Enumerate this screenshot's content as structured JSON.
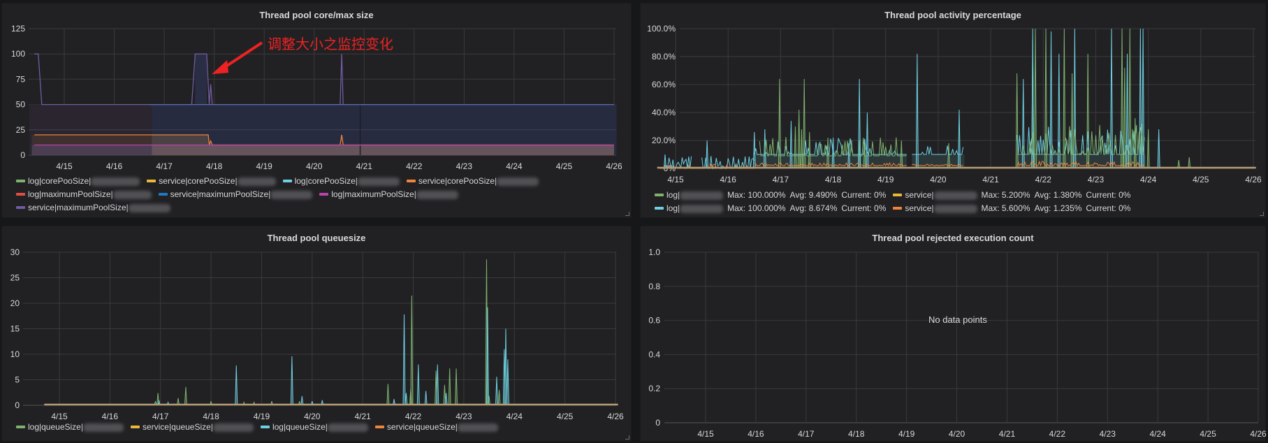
{
  "panels": {
    "core_max": {
      "title": "Thread pool core/max size",
      "annotation": "调整大小之监控变化",
      "legend": [
        {
          "label": "log|corePooSize|",
          "color": "#7eb26d",
          "blur": 70
        },
        {
          "label": "service|corePooSize|",
          "color": "#eab839",
          "blur": 55
        },
        {
          "label": "log|corePooSize|",
          "color": "#6ed0e0",
          "blur": 60
        },
        {
          "label": "service|corePooSize|",
          "color": "#ef843c",
          "blur": 60
        },
        {
          "label": "log|maximumPoolSize|",
          "color": "#e24d42",
          "blur": 55
        },
        {
          "label": "service|maximumPoolSize|",
          "color": "#1f78c1",
          "blur": 60
        },
        {
          "label": "log|maximumPoolSize|",
          "color": "#ba43a9",
          "blur": 60
        },
        {
          "label": "service|maximumPoolSize|",
          "color": "#705da0",
          "blur": 60
        }
      ]
    },
    "activity": {
      "title": "Thread pool activity percentage",
      "legend": [
        {
          "label": "log|",
          "color": "#7eb26d",
          "max": "Max: 100.000%",
          "avg": "Avg: 9.490%",
          "current": "Current: 0%"
        },
        {
          "label": "service|",
          "color": "#eab839",
          "max": "Max: 5.200%",
          "avg": "Avg: 1.380%",
          "current": "Current: 0%"
        },
        {
          "label": "log|",
          "color": "#6ed0e0",
          "max": "Max: 100.000%",
          "avg": "Avg: 8.674%",
          "current": "Current: 0%"
        },
        {
          "label": "service|",
          "color": "#ef843c",
          "max": "Max: 5.600%",
          "avg": "Avg: 1.235%",
          "current": "Current: 0%"
        }
      ]
    },
    "queue": {
      "title": "Thread pool queuesize",
      "legend": [
        {
          "label": "log|queueSize|",
          "color": "#7eb26d"
        },
        {
          "label": "service|queueSize|",
          "color": "#eab839"
        },
        {
          "label": "log|queueSize|",
          "color": "#6ed0e0"
        },
        {
          "label": "service|queueSize|",
          "color": "#ef843c"
        }
      ]
    },
    "rejected": {
      "title": "Thread pool rejected execution count",
      "no_data": "No data points"
    }
  },
  "chart_data": [
    {
      "type": "area",
      "title": "Thread pool core/max size",
      "x_ticks": [
        "4/15",
        "4/16",
        "4/17",
        "4/18",
        "4/19",
        "4/20",
        "4/21",
        "4/22",
        "4/23",
        "4/24",
        "4/25",
        "4/26"
      ],
      "y_ticks": [
        "0",
        "25",
        "50",
        "75",
        "100",
        "125"
      ],
      "ylim": [
        0,
        125
      ],
      "xlim_days": [
        -0.7,
        11.05
      ],
      "grid": true,
      "annotation": {
        "text": "调整大小之监控变化",
        "points_to_day": 3.0,
        "points_to_value": 80
      },
      "series": [
        {
          "name": "service|maximumPoolSize",
          "color": "#705da0",
          "points": [
            [
              -0.6,
              100
            ],
            [
              -0.52,
              100
            ],
            [
              -0.45,
              50
            ],
            [
              2.55,
              50
            ],
            [
              2.62,
              100
            ],
            [
              2.85,
              100
            ],
            [
              2.9,
              50
            ],
            [
              2.93,
              70
            ],
            [
              2.96,
              50
            ],
            [
              5.52,
              50
            ],
            [
              5.55,
              100
            ],
            [
              5.58,
              50
            ],
            [
              11.0,
              50
            ]
          ]
        },
        {
          "name": "service|corePooSize",
          "color": "#ef843c",
          "points": [
            [
              -0.6,
              20
            ],
            [
              2.88,
              20
            ],
            [
              2.9,
              10
            ],
            [
              2.93,
              14
            ],
            [
              2.96,
              10
            ],
            [
              5.52,
              10
            ],
            [
              5.55,
              20
            ],
            [
              5.58,
              10
            ],
            [
              11.0,
              10
            ]
          ]
        },
        {
          "name": "log|maximumPoolSize",
          "color": "#ba43a9",
          "points": [
            [
              -0.6,
              10
            ],
            [
              11.0,
              10
            ]
          ]
        },
        {
          "name": "service|maximumPoolSize (blue)",
          "color": "#1f78c1",
          "points": [
            [
              1.7,
              50
            ],
            [
              11.0,
              50
            ]
          ]
        }
      ]
    },
    {
      "type": "line",
      "title": "Thread pool activity percentage",
      "x_ticks": [
        "4/15",
        "4/16",
        "4/17",
        "4/18",
        "4/19",
        "4/20",
        "4/21",
        "4/22",
        "4/23",
        "4/24",
        "4/25",
        "4/26"
      ],
      "y_ticks": [
        "0%",
        "20.0%",
        "40.0%",
        "60.0%",
        "80.0%",
        "100.0%"
      ],
      "ylim": [
        0,
        100
      ],
      "grid": true,
      "series": [
        {
          "name": "log|",
          "color": "#7eb26d",
          "max": 100,
          "avg": 9.49,
          "current": 0,
          "spikes": [
            [
              1.98,
              64
            ],
            [
              2.45,
              64
            ],
            [
              2.35,
              42
            ],
            [
              2.28,
              30
            ],
            [
              2.4,
              28
            ],
            [
              2.55,
              26
            ],
            [
              2.9,
              22
            ],
            [
              3.5,
              20
            ],
            [
              3.6,
              18
            ],
            [
              4.3,
              20
            ],
            [
              5.2,
              18
            ],
            [
              6.5,
              68
            ],
            [
              6.8,
              92
            ],
            [
              6.85,
              100
            ],
            [
              7.05,
              100
            ],
            [
              7.4,
              100
            ],
            [
              7.55,
              68
            ],
            [
              7.85,
              82
            ],
            [
              8.5,
              100
            ],
            [
              8.55,
              72
            ],
            [
              8.65,
              100
            ],
            [
              8.75,
              36
            ],
            [
              9.0,
              28
            ],
            [
              9.58,
              6
            ],
            [
              9.78,
              8
            ]
          ]
        },
        {
          "name": "service|",
          "color": "#eab839",
          "max": 5.2,
          "avg": 1.38,
          "current": 0
        },
        {
          "name": "log|",
          "color": "#6ed0e0",
          "max": 100,
          "avg": 8.674,
          "current": 0,
          "spikes": [
            [
              -0.2,
              10
            ],
            [
              0.6,
              20
            ],
            [
              1.5,
              26
            ],
            [
              1.7,
              28
            ],
            [
              2.2,
              34
            ],
            [
              3.0,
              22
            ],
            [
              3.3,
              18
            ],
            [
              3.5,
              64
            ],
            [
              3.65,
              40
            ],
            [
              4.6,
              82
            ],
            [
              5.4,
              42
            ],
            [
              6.62,
              64
            ],
            [
              6.8,
              100
            ],
            [
              7.15,
              98
            ],
            [
              7.3,
              82
            ],
            [
              7.6,
              100
            ],
            [
              8.3,
              100
            ],
            [
              8.6,
              82
            ],
            [
              8.85,
              100
            ],
            [
              8.9,
              100
            ],
            [
              9.2,
              28
            ]
          ]
        },
        {
          "name": "service|",
          "color": "#ef843c",
          "max": 5.6,
          "avg": 1.235,
          "current": 0
        }
      ]
    },
    {
      "type": "line",
      "title": "Thread pool queuesize",
      "x_ticks": [
        "4/15",
        "4/16",
        "4/17",
        "4/18",
        "4/19",
        "4/20",
        "4/21",
        "4/22",
        "4/23",
        "4/24",
        "4/25",
        "4/26"
      ],
      "y_ticks": [
        "0",
        "5",
        "10",
        "15",
        "20",
        "25",
        "30"
      ],
      "ylim": [
        0,
        30
      ],
      "grid": true,
      "series": [
        {
          "name": "log|queueSize|",
          "color": "#7eb26d",
          "spikes": [
            [
              1.95,
              2.4
            ],
            [
              1.9,
              0.8
            ],
            [
              2.35,
              1.4
            ],
            [
              2.5,
              3.6
            ],
            [
              3.0,
              0.8
            ],
            [
              3.65,
              0.6
            ],
            [
              3.85,
              0.6
            ],
            [
              4.2,
              0.8
            ],
            [
              4.75,
              0.8
            ],
            [
              6.5,
              4.2
            ],
            [
              6.97,
              21.5
            ],
            [
              6.95,
              3.2
            ],
            [
              7.45,
              6.8
            ],
            [
              7.62,
              4.0
            ],
            [
              7.72,
              7.2
            ],
            [
              7.85,
              7.2
            ],
            [
              8.45,
              28.6
            ],
            [
              8.5,
              1.8
            ],
            [
              8.7,
              3.0
            ]
          ]
        },
        {
          "name": "service|queueSize|",
          "color": "#eab839"
        },
        {
          "name": "log|queueSize|",
          "color": "#6ed0e0",
          "spikes": [
            [
              1.97,
              1.0
            ],
            [
              2.15,
              0.6
            ],
            [
              3.5,
              7.8
            ],
            [
              4.6,
              9.6
            ],
            [
              4.8,
              1.8
            ],
            [
              5.0,
              0.8
            ],
            [
              5.2,
              1.0
            ],
            [
              6.62,
              1.2
            ],
            [
              6.82,
              17.8
            ],
            [
              6.86,
              2.4
            ],
            [
              7.1,
              8.0
            ],
            [
              7.25,
              2.8
            ],
            [
              7.48,
              8.0
            ],
            [
              7.65,
              2.4
            ],
            [
              8.47,
              19.2
            ],
            [
              8.65,
              5.6
            ],
            [
              8.83,
              15.0
            ],
            [
              8.8,
              11.0
            ],
            [
              8.87,
              9.0
            ]
          ]
        },
        {
          "name": "service|queueSize|",
          "color": "#ef843c"
        }
      ]
    },
    {
      "type": "line",
      "title": "Thread pool rejected execution count",
      "x_ticks": [
        "4/15",
        "4/16",
        "4/17",
        "4/18",
        "4/19",
        "4/20",
        "4/21",
        "4/22",
        "4/23",
        "4/24",
        "4/25",
        "4/26"
      ],
      "y_ticks": [
        "0",
        "0.2",
        "0.4",
        "0.6",
        "0.8",
        "1.0"
      ],
      "ylim": [
        0,
        1
      ],
      "grid": true,
      "series": [],
      "annotation": "No data points"
    }
  ]
}
